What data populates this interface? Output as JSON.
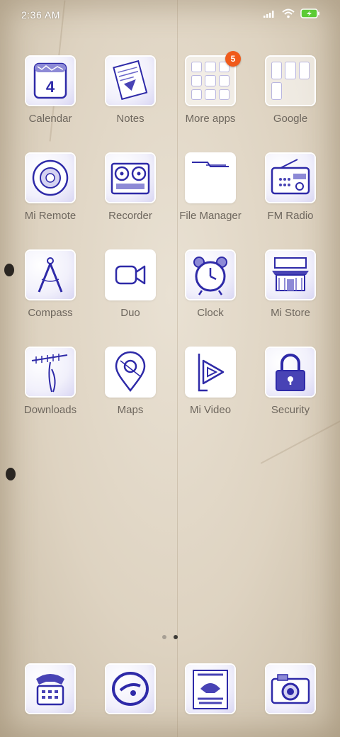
{
  "status_bar": {
    "time": "2:36 AM",
    "icons": [
      "signal-icon",
      "wifi-icon",
      "battery-charging-icon"
    ]
  },
  "apps": [
    {
      "label": "Calendar",
      "icon": "calendar-icon",
      "icon_text": "4"
    },
    {
      "label": "Notes",
      "icon": "notes-icon"
    },
    {
      "label": "More apps",
      "icon": "folder-icon",
      "badge": "5"
    },
    {
      "label": "Google",
      "icon": "google-folder-icon"
    },
    {
      "label": "Mi Remote",
      "icon": "remote-icon"
    },
    {
      "label": "Recorder",
      "icon": "tape-recorder-icon"
    },
    {
      "label": "File Manager",
      "icon": "file-folder-icon"
    },
    {
      "label": "FM Radio",
      "icon": "radio-icon"
    },
    {
      "label": "Compass",
      "icon": "compass-divider-icon"
    },
    {
      "label": "Duo",
      "icon": "video-camera-icon"
    },
    {
      "label": "Clock",
      "icon": "alarm-clock-icon"
    },
    {
      "label": "Mi Store",
      "icon": "store-icon"
    },
    {
      "label": "Downloads",
      "icon": "antenna-icon"
    },
    {
      "label": "Maps",
      "icon": "map-pin-icon"
    },
    {
      "label": "Mi Video",
      "icon": "play-icon"
    },
    {
      "label": "Security",
      "icon": "padlock-icon"
    }
  ],
  "dock": [
    {
      "icon": "telephone-icon"
    },
    {
      "icon": "messages-icon"
    },
    {
      "icon": "poster-icon"
    },
    {
      "icon": "camera-icon"
    }
  ],
  "pager": {
    "pages": 2,
    "current": 2
  },
  "colors": {
    "ink": "#2e2aa8",
    "label": "#6e675e",
    "badge": "#f05a1a",
    "paper": "#e2d8c6"
  }
}
